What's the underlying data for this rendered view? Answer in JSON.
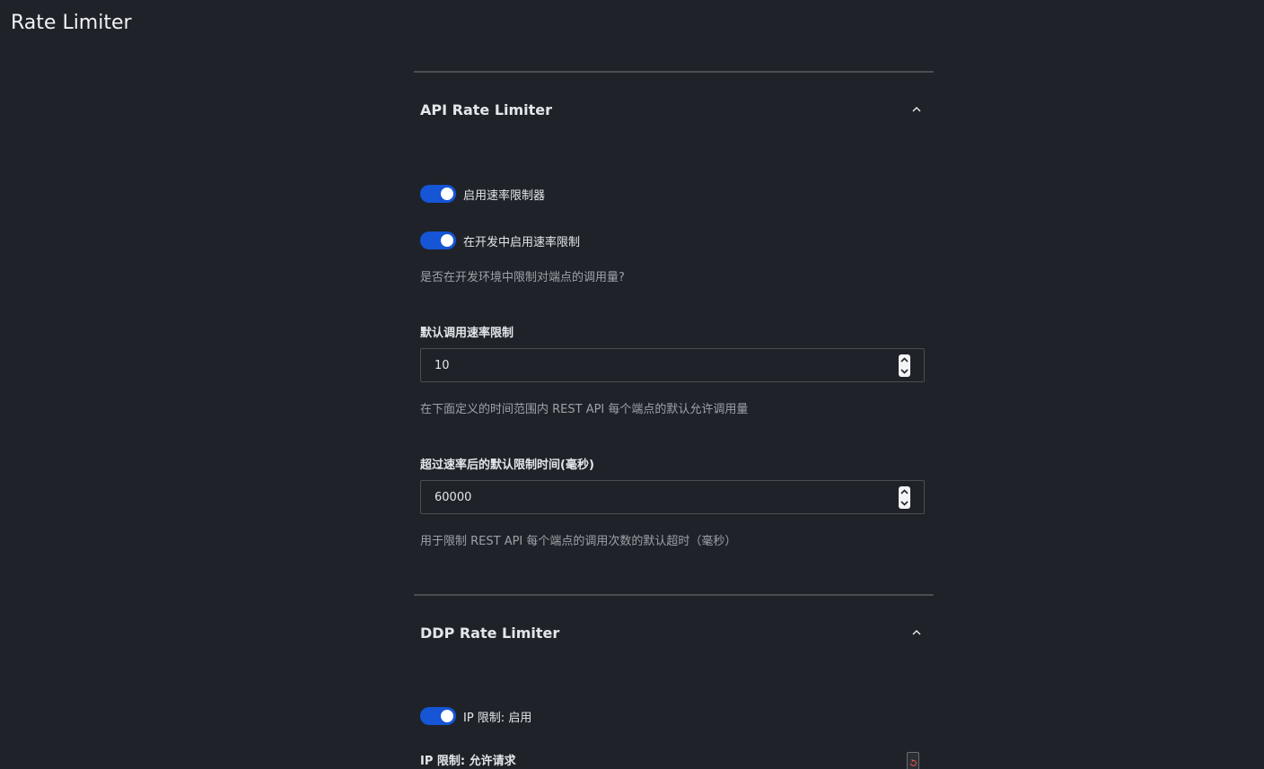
{
  "page": {
    "title": "Rate Limiter"
  },
  "api_section": {
    "title": "API Rate Limiter",
    "enable_toggle": {
      "label": "启用速率限制器",
      "on": true
    },
    "dev_toggle": {
      "label": "在开发中启用速率限制",
      "on": true
    },
    "dev_hint": "是否在开发环境中限制对端点的调用量?",
    "default_rate": {
      "label": "默认调用速率限制",
      "value": "10",
      "hint": "在下面定义的时间范围内 REST API 每个端点的默认允许调用量"
    },
    "default_timeout": {
      "label": "超过速率后的默认限制时间(毫秒)",
      "value": "60000",
      "hint": "用于限制 REST API 每个端点的调用次数的默认超时（毫秒）"
    }
  },
  "ddp_section": {
    "title": "DDP Rate Limiter",
    "ip_toggle": {
      "label": "IP 限制: 启用",
      "on": true
    },
    "ip_requests_label": "IP 限制: 允许请求"
  },
  "colors": {
    "background": "#1f2329",
    "toggle_on": "#1555d6",
    "divider": "#4a4e53",
    "hint_text": "#9ea2a8"
  },
  "icons": {
    "collapse": "chevron-up-icon",
    "stepper": "stepper-icon",
    "reset": "reset-icon"
  }
}
